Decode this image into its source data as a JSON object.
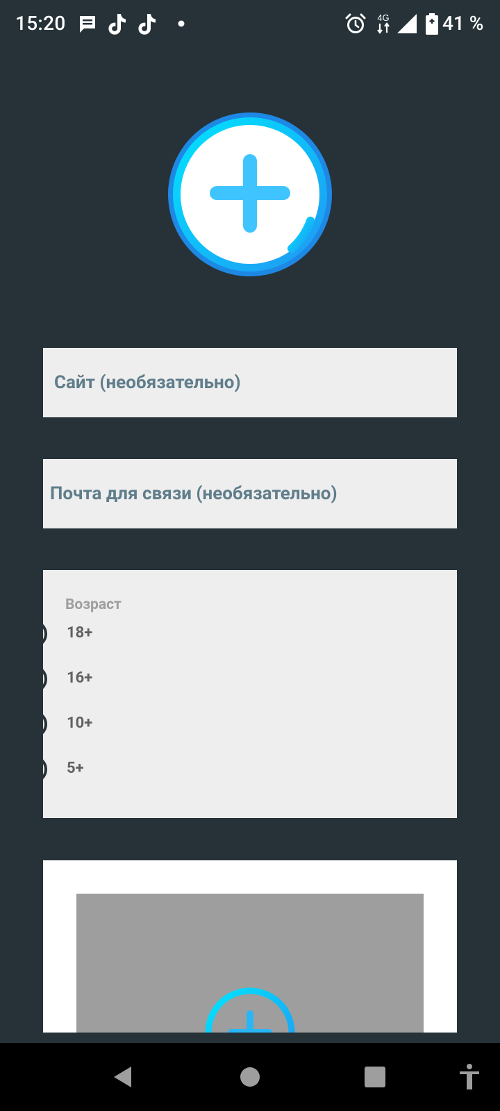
{
  "status_bar": {
    "time": "15:20",
    "battery_percent": "41 %",
    "network_label": "4G",
    "notification_icons": [
      "message-icon",
      "tiktok-icon",
      "tiktok-icon",
      "more-dot-icon"
    ],
    "system_icons": [
      "alarm-icon",
      "network-4g-icon",
      "signal-icon",
      "battery-charging-icon"
    ]
  },
  "avatar": {
    "icon": "add-circle-icon",
    "accent_colors": [
      "#00e5ff",
      "#2196f3"
    ]
  },
  "form": {
    "site_placeholder": "Сайт (необязательно)",
    "email_placeholder": "Почта для связи (необязательно)",
    "age": {
      "title": "Возраст",
      "options": [
        "18+",
        "16+",
        "10+",
        "5+"
      ],
      "selected": null
    },
    "image_upload": {
      "icon": "add-circle-icon"
    }
  },
  "nav_bar": {
    "icons": [
      "back-icon",
      "home-icon",
      "recents-icon",
      "accessibility-icon"
    ]
  },
  "colors": {
    "background": "#263238",
    "field_background": "#eeeeee",
    "field_text": "#607d8b",
    "label_text": "#616161",
    "age_title": "#9e9e9e",
    "image_placeholder": "#9e9e9e",
    "accent": "#29b6f6"
  }
}
